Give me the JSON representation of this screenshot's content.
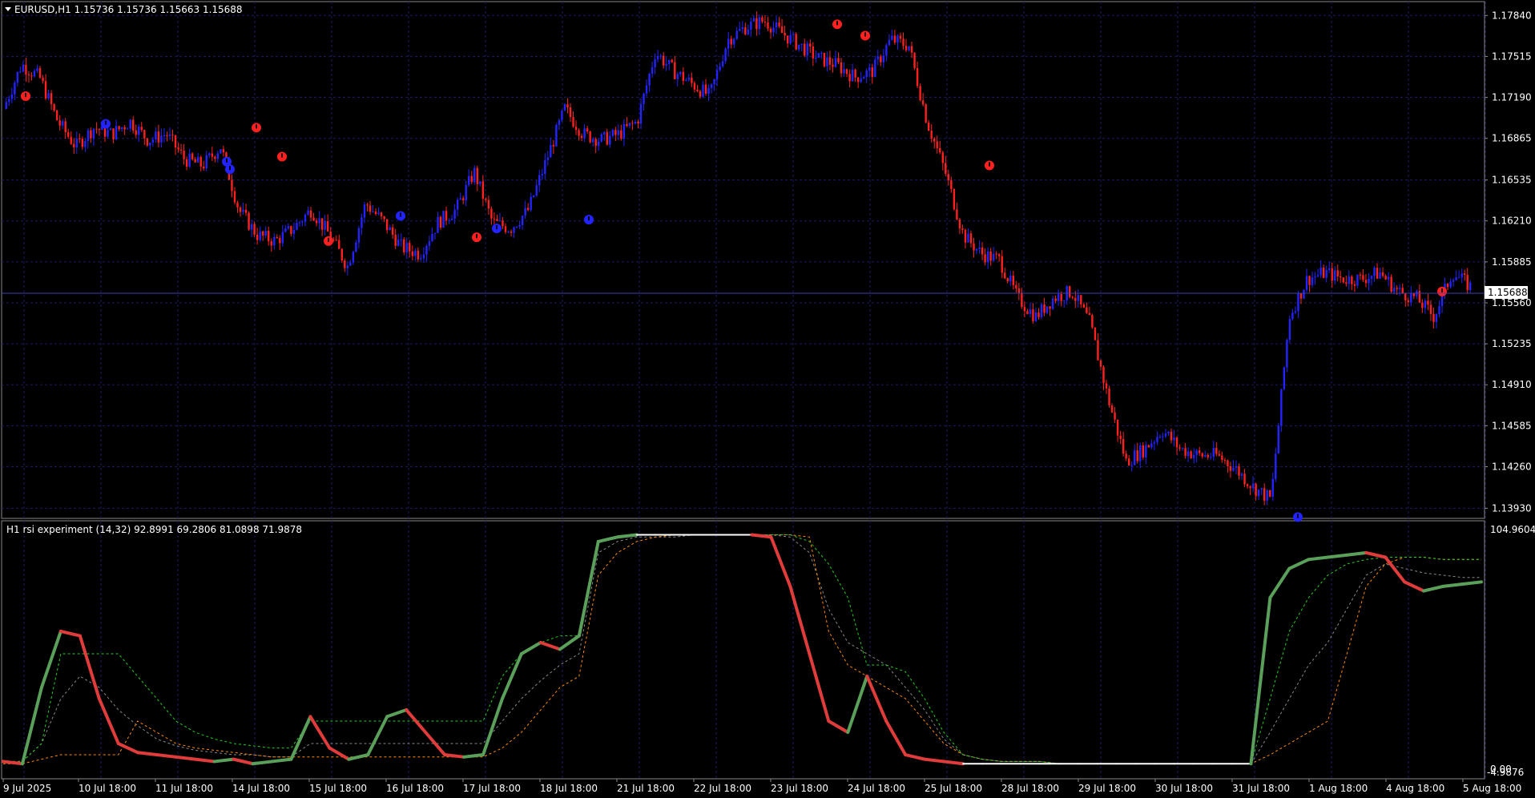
{
  "window": {
    "symbol_header": "EURUSD,H1  1.15736 1.15736 1.15663 1.15688"
  },
  "price_panel": {
    "current_price_label": "1.15688",
    "price_levels": [
      "1.17840",
      "1.17515",
      "1.17190",
      "1.16865",
      "1.16535",
      "1.16210",
      "1.15885",
      "1.15560",
      "1.15235",
      "1.14910",
      "1.14585",
      "1.14260",
      "1.13930"
    ]
  },
  "indicator_panel": {
    "header": "H1 rsi experiment (14,32) 92.8991 69.2806 81.0898 71.9878",
    "max_label": "104.9604",
    "min_label": "0.00",
    "extra_label": "-4.9876"
  },
  "time_axis": {
    "labels": [
      "9 Jul 2025",
      "10 Jul 18:00",
      "11 Jul 18:00",
      "14 Jul 18:00",
      "15 Jul 18:00",
      "16 Jul 18:00",
      "17 Jul 18:00",
      "18 Jul 18:00",
      "21 Jul 18:00",
      "22 Jul 18:00",
      "23 Jul 18:00",
      "24 Jul 18:00",
      "25 Jul 18:00",
      "28 Jul 18:00",
      "29 Jul 18:00",
      "30 Jul 18:00",
      "31 Jul 18:00",
      "1 Aug 18:00",
      "4 Aug 18:00",
      "5 Aug 18:00"
    ]
  },
  "colors": {
    "background": "#000000",
    "grid": "#1a1a66",
    "bull_candle": "#2323ff",
    "bear_candle": "#ff2020",
    "rsi_up": "#5aa05a",
    "rsi_down": "#e03c3c",
    "rsi_neutral": "#ffffff",
    "signal_green": "#22cc22",
    "signal_orange": "#ff8800",
    "signal_gray": "#888888"
  },
  "chart_data": [
    {
      "type": "candlestick",
      "title": "EURUSD,H1",
      "ylim": [
        1.1385,
        1.1795
      ],
      "x": [
        "9 Jul 2025",
        "10 Jul 18:00",
        "11 Jul 18:00",
        "14 Jul 18:00",
        "15 Jul 18:00",
        "16 Jul 18:00",
        "17 Jul 18:00",
        "18 Jul 18:00",
        "21 Jul 18:00",
        "22 Jul 18:00",
        "23 Jul 18:00",
        "24 Jul 18:00",
        "25 Jul 18:00",
        "28 Jul 18:00",
        "29 Jul 18:00",
        "30 Jul 18:00",
        "31 Jul 18:00",
        "1 Aug 18:00",
        "4 Aug 18:00",
        "5 Aug 18:00"
      ],
      "close_path": [
        1.171,
        1.1745,
        1.1735,
        1.17,
        1.168,
        1.1695,
        1.169,
        1.17,
        1.1685,
        1.169,
        1.167,
        1.1665,
        1.168,
        1.163,
        1.161,
        1.1605,
        1.1615,
        1.163,
        1.161,
        1.1585,
        1.1635,
        1.162,
        1.16,
        1.1595,
        1.162,
        1.163,
        1.166,
        1.162,
        1.1615,
        1.163,
        1.167,
        1.171,
        1.169,
        1.1685,
        1.169,
        1.17,
        1.1755,
        1.174,
        1.173,
        1.172,
        1.1765,
        1.1775,
        1.178,
        1.177,
        1.176,
        1.175,
        1.1745,
        1.1735,
        1.174,
        1.1765,
        1.176,
        1.17,
        1.166,
        1.161,
        1.1595,
        1.159,
        1.156,
        1.1545,
        1.156,
        1.1565,
        1.154,
        1.148,
        1.143,
        1.144,
        1.1455,
        1.144,
        1.1435,
        1.1435,
        1.1425,
        1.141,
        1.14,
        1.1545,
        1.1575,
        1.158,
        1.1575,
        1.1575,
        1.158,
        1.1565,
        1.156,
        1.1545,
        1.158,
        1.1569
      ],
      "signals": [
        {
          "type": "sell",
          "price": 1.172
        },
        {
          "type": "buy",
          "price": 1.1698
        },
        {
          "type": "sell",
          "price": 1.1695
        },
        {
          "type": "buy",
          "price": 1.1668
        },
        {
          "type": "sell",
          "price": 1.1672
        },
        {
          "type": "buy",
          "price": 1.1662
        },
        {
          "type": "sell",
          "price": 1.1605
        },
        {
          "type": "buy",
          "price": 1.1625
        },
        {
          "type": "sell",
          "price": 1.1608
        },
        {
          "type": "buy",
          "price": 1.1615
        },
        {
          "type": "buy",
          "price": 1.1622
        },
        {
          "type": "sell",
          "price": 1.1777
        },
        {
          "type": "sell",
          "price": 1.1768
        },
        {
          "type": "sell",
          "price": 1.1665
        },
        {
          "type": "buy",
          "price": 1.1386
        },
        {
          "type": "sell",
          "price": 1.1565
        }
      ]
    },
    {
      "type": "line",
      "title": "H1 rsi experiment (14,32)",
      "ylim": [
        -4.9876,
        104.9604
      ],
      "series": [
        {
          "name": "rsi",
          "values": [
            2,
            1,
            35,
            60,
            58,
            30,
            10,
            6,
            5,
            4,
            3,
            2,
            3,
            1,
            2,
            3,
            22,
            8,
            3,
            5,
            22,
            25,
            15,
            5,
            4,
            5,
            30,
            50,
            55,
            52,
            58,
            100,
            102,
            103,
            103,
            103,
            103,
            103,
            103,
            103,
            102,
            80,
            50,
            20,
            15,
            40,
            20,
            5,
            3,
            2,
            1,
            1,
            1,
            1,
            1,
            1,
            1,
            1,
            1,
            1,
            1,
            1,
            1,
            1,
            1,
            1,
            75,
            88,
            92,
            93,
            94,
            95,
            93,
            82,
            78,
            80,
            81,
            82
          ]
        },
        {
          "name": "signal_green",
          "values": [
            2,
            2,
            10,
            50,
            50,
            50,
            50,
            40,
            30,
            20,
            15,
            12,
            10,
            9,
            8,
            8,
            20,
            20,
            20,
            20,
            20,
            20,
            20,
            20,
            20,
            20,
            40,
            50,
            55,
            58,
            58,
            100,
            102,
            103,
            103,
            103,
            103,
            103,
            103,
            103,
            103,
            103,
            100,
            90,
            75,
            45,
            45,
            42,
            30,
            15,
            5,
            3,
            2,
            2,
            2,
            1,
            1,
            1,
            1,
            1,
            1,
            1,
            1,
            1,
            1,
            1,
            30,
            60,
            75,
            85,
            90,
            92,
            93,
            93,
            93,
            92,
            92,
            92
          ]
        },
        {
          "name": "signal_orange",
          "values": [
            1,
            1,
            3,
            5,
            5,
            5,
            5,
            20,
            15,
            10,
            8,
            7,
            6,
            5,
            4,
            4,
            4,
            4,
            4,
            4,
            4,
            4,
            4,
            4,
            4,
            4,
            8,
            15,
            25,
            35,
            40,
            85,
            95,
            100,
            102,
            103,
            103,
            103,
            103,
            103,
            103,
            103,
            102,
            60,
            45,
            40,
            35,
            30,
            20,
            10,
            5,
            3,
            2,
            2,
            2,
            1,
            1,
            1,
            1,
            1,
            1,
            1,
            1,
            1,
            1,
            1,
            5,
            10,
            15,
            20,
            50,
            80,
            90,
            93,
            93,
            92,
            92,
            92
          ]
        },
        {
          "name": "signal_gray",
          "values": [
            2,
            2,
            10,
            30,
            40,
            35,
            25,
            18,
            12,
            9,
            7,
            6,
            5,
            5,
            4,
            4,
            10,
            10,
            10,
            10,
            10,
            10,
            10,
            10,
            10,
            10,
            20,
            30,
            38,
            45,
            50,
            95,
            100,
            102,
            102,
            102,
            103,
            103,
            103,
            103,
            103,
            102,
            95,
            70,
            55,
            50,
            45,
            35,
            25,
            12,
            5,
            3,
            2,
            2,
            2,
            1,
            1,
            1,
            1,
            1,
            1,
            1,
            1,
            1,
            1,
            1,
            15,
            30,
            45,
            55,
            70,
            85,
            90,
            88,
            86,
            85,
            84,
            84
          ]
        }
      ]
    }
  ]
}
